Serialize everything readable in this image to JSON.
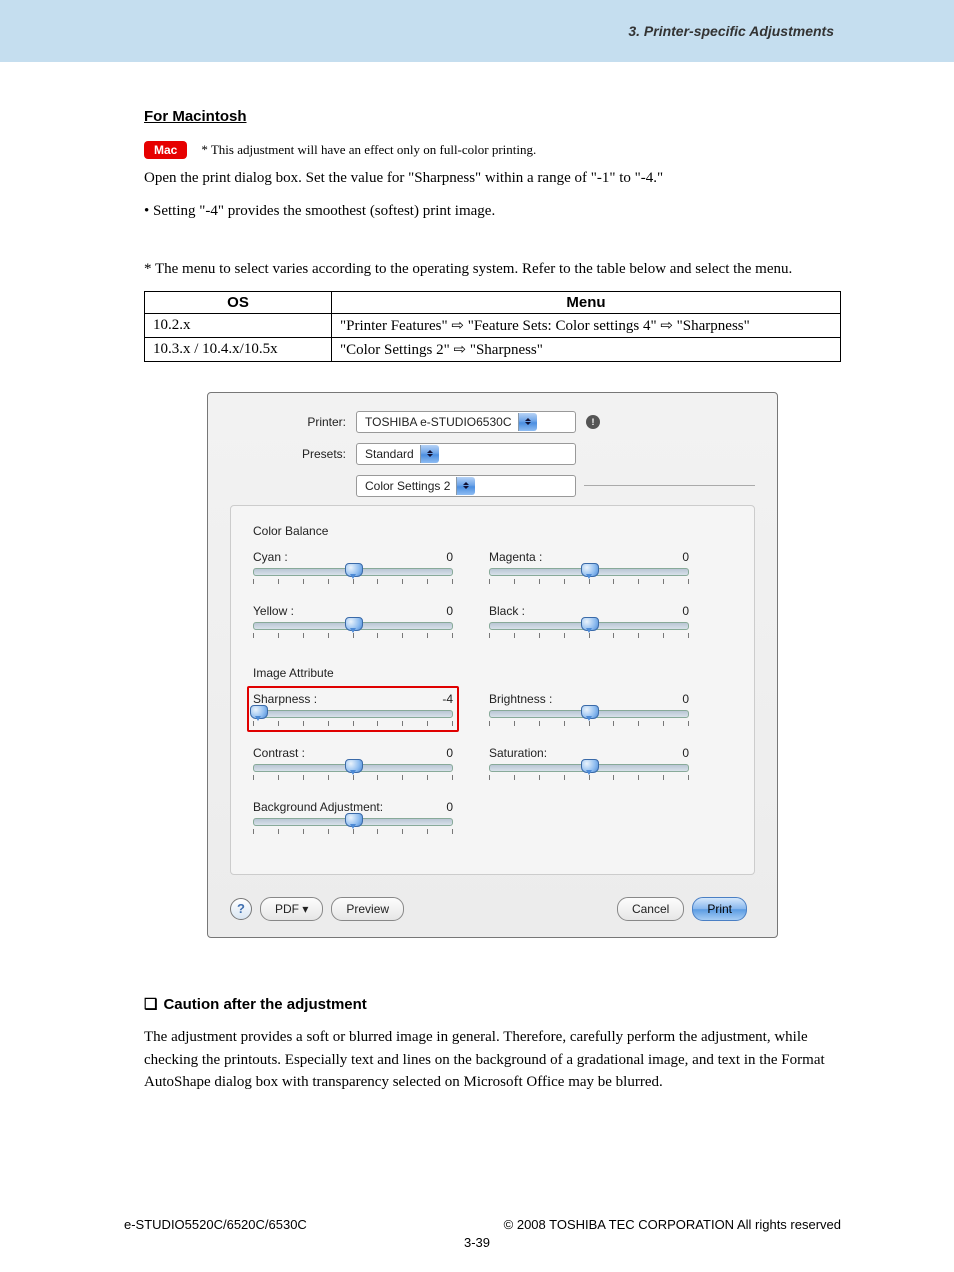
{
  "header": {
    "section": "3. Printer-specific Adjustments"
  },
  "body": {
    "heading": "For Macintosh",
    "badge": "Mac",
    "badge_note": "* This adjustment will have an effect only on full-color printing.",
    "line1": "Open the print dialog box.  Set the value for \"Sharpness\" within a range of \"-1\" to \"-4.\"",
    "line2": "• Setting \"-4\" provides the smoothest (softest) print image.",
    "table_intro": "* The menu to select varies according to the operating system.  Refer to the table below and select the menu."
  },
  "table": {
    "headers": [
      "OS",
      "Menu"
    ],
    "rows": [
      {
        "os": "10.2.x",
        "menu": "\"Printer Features\" ⇨ \"Feature Sets: Color settings 4\" ⇨ \"Sharpness\""
      },
      {
        "os": "10.3.x / 10.4.x/10.5x",
        "menu": "\"Color Settings 2\" ⇨ \"Sharpness\""
      }
    ]
  },
  "dialog": {
    "printer_label": "Printer:",
    "printer_value": "TOSHIBA e-STUDIO6530C",
    "presets_label": "Presets:",
    "presets_value": "Standard",
    "pane_value": "Color Settings 2",
    "section1": "Color Balance",
    "section2": "Image Attribute",
    "sliders": {
      "cyan": {
        "label": "Cyan :",
        "value": "0"
      },
      "magenta": {
        "label": "Magenta :",
        "value": "0"
      },
      "yellow": {
        "label": "Yellow :",
        "value": "0"
      },
      "black": {
        "label": "Black :",
        "value": "0"
      },
      "sharpness": {
        "label": "Sharpness :",
        "value": "-4"
      },
      "brightness": {
        "label": "Brightness :",
        "value": "0"
      },
      "contrast": {
        "label": "Contrast :",
        "value": "0"
      },
      "saturation": {
        "label": "Saturation:",
        "value": "0"
      },
      "bgadj": {
        "label": "Background Adjustment:",
        "value": "0"
      }
    },
    "buttons": {
      "pdf": "PDF ▾",
      "preview": "Preview",
      "cancel": "Cancel",
      "print": "Print"
    }
  },
  "caution": {
    "heading": "Caution after the adjustment",
    "text": "The adjustment provides a soft or blurred image in general.  Therefore, carefully perform the adjustment, while checking the printouts.  Especially text and lines on the background of a gradational image, and text in the Format AutoShape dialog box with transparency selected on Microsoft Office may be blurred."
  },
  "footer": {
    "left": "e-STUDIO5520C/6520C/6530C",
    "right": "© 2008 TOSHIBA TEC CORPORATION All rights reserved",
    "page": "3-39"
  }
}
